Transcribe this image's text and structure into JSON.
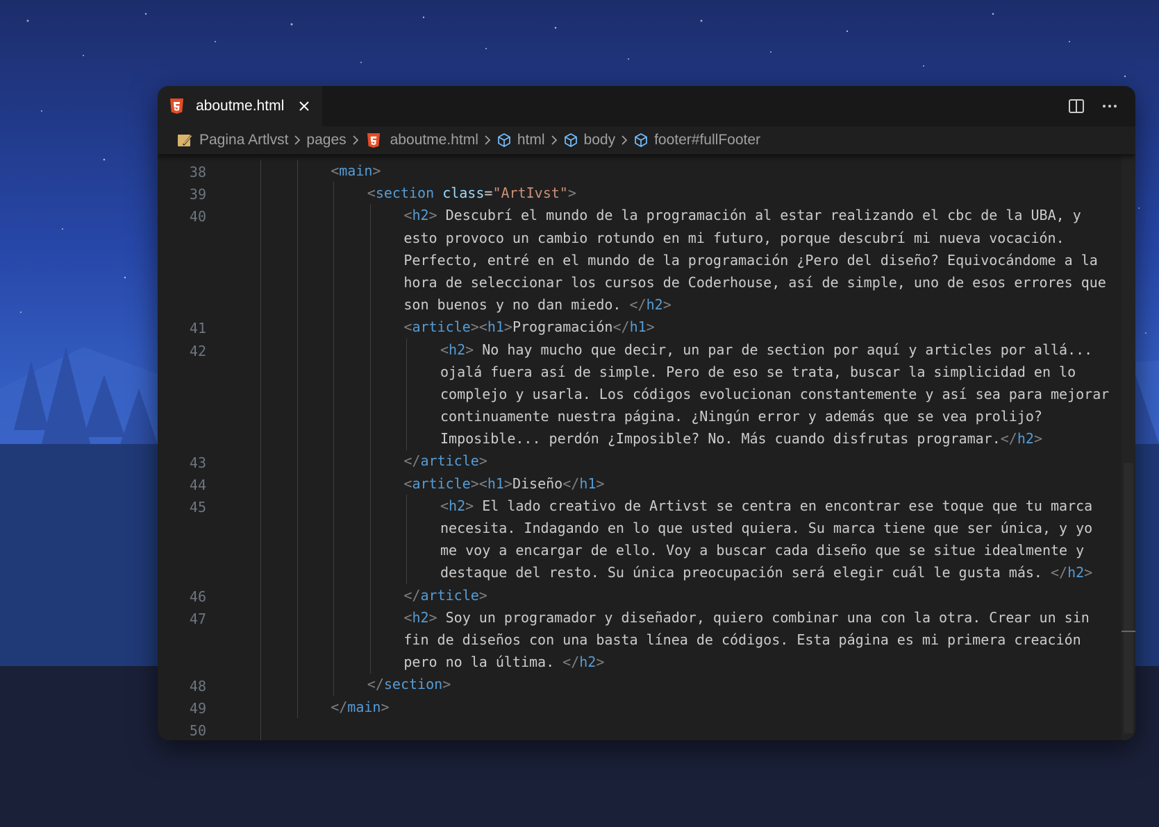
{
  "tab": {
    "file_name": "aboutme.html",
    "file_icon": "html5-icon",
    "close_icon": "close-icon"
  },
  "window_actions": [
    {
      "name": "split-editor-icon",
      "interactable": true
    },
    {
      "name": "more-actions-icon",
      "interactable": true
    }
  ],
  "breadcrumb": [
    {
      "label": "Pagina Artlvst",
      "icon": "folder-icon"
    },
    {
      "label": "pages",
      "icon": ""
    },
    {
      "label": "aboutme.html",
      "icon": "html5-icon"
    },
    {
      "label": "html",
      "icon": "element-cube-icon"
    },
    {
      "label": "body",
      "icon": "element-cube-icon"
    },
    {
      "label": "footer#fullFooter",
      "icon": "element-cube-icon"
    }
  ],
  "line_numbers": [
    {
      "n": "38",
      "row": 0
    },
    {
      "n": "39",
      "row": 1
    },
    {
      "n": "40",
      "row": 2
    },
    {
      "n": "41",
      "row": 7
    },
    {
      "n": "42",
      "row": 8
    },
    {
      "n": "43",
      "row": 13
    },
    {
      "n": "44",
      "row": 14
    },
    {
      "n": "45",
      "row": 15
    },
    {
      "n": "46",
      "row": 19
    },
    {
      "n": "47",
      "row": 20
    },
    {
      "n": "48",
      "row": 23
    },
    {
      "n": "49",
      "row": 24
    },
    {
      "n": "50",
      "row": 25
    }
  ],
  "code_rows": [
    {
      "indent": 2,
      "tokens": [
        [
          "pun",
          "<"
        ],
        [
          "tag",
          "main"
        ],
        [
          "pun",
          ">"
        ]
      ]
    },
    {
      "indent": 3,
      "tokens": [
        [
          "pun",
          "<"
        ],
        [
          "tag",
          "section"
        ],
        [
          "txt",
          " "
        ],
        [
          "attr",
          "class"
        ],
        [
          "txt",
          "="
        ],
        [
          "str",
          "\"ArtIvst\""
        ],
        [
          "pun",
          ">"
        ]
      ]
    },
    {
      "indent": 4,
      "tokens": [
        [
          "pun",
          "<"
        ],
        [
          "tag",
          "h2"
        ],
        [
          "pun",
          ">"
        ],
        [
          "txt",
          " Descubrí el mundo de la programación al estar realizando el cbc de la UBA, y"
        ]
      ]
    },
    {
      "indent": 4,
      "tokens": [
        [
          "txt",
          "esto provoco un cambio rotundo en mi futuro, porque descubrí mi nueva vocación."
        ]
      ]
    },
    {
      "indent": 4,
      "tokens": [
        [
          "txt",
          "Perfecto, entré en el mundo de la programación ¿Pero del diseño? Equivocándome a la"
        ]
      ]
    },
    {
      "indent": 4,
      "tokens": [
        [
          "txt",
          "hora de seleccionar los cursos de Coderhouse, así de simple, uno de esos errores que"
        ]
      ]
    },
    {
      "indent": 4,
      "tokens": [
        [
          "txt",
          "son buenos y no dan miedo. "
        ],
        [
          "pun",
          "</"
        ],
        [
          "tag",
          "h2"
        ],
        [
          "pun",
          ">"
        ]
      ]
    },
    {
      "indent": 4,
      "tokens": [
        [
          "pun",
          "<"
        ],
        [
          "tag",
          "article"
        ],
        [
          "pun",
          "><"
        ],
        [
          "tag",
          "h1"
        ],
        [
          "pun",
          ">"
        ],
        [
          "txt",
          "Programación"
        ],
        [
          "pun",
          "</"
        ],
        [
          "tag",
          "h1"
        ],
        [
          "pun",
          ">"
        ]
      ]
    },
    {
      "indent": 5,
      "tokens": [
        [
          "pun",
          "<"
        ],
        [
          "tag",
          "h2"
        ],
        [
          "pun",
          ">"
        ],
        [
          "txt",
          " No hay mucho que decir, un par de section por aquí y articles por allá..."
        ]
      ]
    },
    {
      "indent": 5,
      "tokens": [
        [
          "txt",
          "ojalá fuera así de simple. Pero de eso se trata, buscar la simplicidad en lo"
        ]
      ]
    },
    {
      "indent": 5,
      "tokens": [
        [
          "txt",
          "complejo y usarla. Los códigos evolucionan constantemente y así sea para mejorar"
        ]
      ]
    },
    {
      "indent": 5,
      "tokens": [
        [
          "txt",
          "continuamente nuestra página. ¿Ningún error y además que se vea prolijo?"
        ]
      ]
    },
    {
      "indent": 5,
      "tokens": [
        [
          "txt",
          "Imposible... perdón ¿Imposible? No. Más cuando disfrutas programar."
        ],
        [
          "pun",
          "</"
        ],
        [
          "tag",
          "h2"
        ],
        [
          "pun",
          ">"
        ]
      ]
    },
    {
      "indent": 4,
      "tokens": [
        [
          "pun",
          "</"
        ],
        [
          "tag",
          "article"
        ],
        [
          "pun",
          ">"
        ]
      ]
    },
    {
      "indent": 4,
      "tokens": [
        [
          "pun",
          "<"
        ],
        [
          "tag",
          "article"
        ],
        [
          "pun",
          "><"
        ],
        [
          "tag",
          "h1"
        ],
        [
          "pun",
          ">"
        ],
        [
          "txt",
          "Diseño"
        ],
        [
          "pun",
          "</"
        ],
        [
          "tag",
          "h1"
        ],
        [
          "pun",
          ">"
        ]
      ]
    },
    {
      "indent": 5,
      "tokens": [
        [
          "pun",
          "<"
        ],
        [
          "tag",
          "h2"
        ],
        [
          "pun",
          ">"
        ],
        [
          "txt",
          " El lado creativo de Artivst se centra en encontrar ese toque que tu marca"
        ]
      ]
    },
    {
      "indent": 5,
      "tokens": [
        [
          "txt",
          "necesita. Indagando en lo que usted quiera. Su marca tiene que ser única, y yo"
        ]
      ]
    },
    {
      "indent": 5,
      "tokens": [
        [
          "txt",
          "me voy a encargar de ello. Voy a buscar cada diseño que se situe idealmente y"
        ]
      ]
    },
    {
      "indent": 5,
      "tokens": [
        [
          "txt",
          "destaque del resto. Su única preocupación será elegir cuál le gusta más. "
        ],
        [
          "pun",
          "</"
        ],
        [
          "tag",
          "h2"
        ],
        [
          "pun",
          ">"
        ]
      ]
    },
    {
      "indent": 4,
      "tokens": [
        [
          "pun",
          "</"
        ],
        [
          "tag",
          "article"
        ],
        [
          "pun",
          ">"
        ]
      ]
    },
    {
      "indent": 4,
      "tokens": [
        [
          "pun",
          "<"
        ],
        [
          "tag",
          "h2"
        ],
        [
          "pun",
          ">"
        ],
        [
          "txt",
          " Soy un programador y diseñador, quiero combinar una con la otra. Crear un sin"
        ]
      ]
    },
    {
      "indent": 4,
      "tokens": [
        [
          "txt",
          "fin de diseños con una basta línea de códigos. Esta página es mi primera creación"
        ]
      ]
    },
    {
      "indent": 4,
      "tokens": [
        [
          "txt",
          "pero no la última. "
        ],
        [
          "pun",
          "</"
        ],
        [
          "tag",
          "h2"
        ],
        [
          "pun",
          ">"
        ]
      ]
    },
    {
      "indent": 3,
      "tokens": [
        [
          "pun",
          "</"
        ],
        [
          "tag",
          "section"
        ],
        [
          "pun",
          ">"
        ]
      ]
    },
    {
      "indent": 2,
      "tokens": [
        [
          "pun",
          "</"
        ],
        [
          "tag",
          "main"
        ],
        [
          "pun",
          ">"
        ]
      ]
    },
    {
      "indent": 0,
      "tokens": []
    }
  ],
  "colors": {
    "editor_bg": "#1f1f1f",
    "tabbar_bg": "#181818",
    "tag": "#569cd6",
    "attribute": "#9cdcfe",
    "string": "#ce9178",
    "punctuation": "#808080",
    "text": "#cccccc",
    "line_number": "#6e7681",
    "html_icon": "#e44d26"
  }
}
